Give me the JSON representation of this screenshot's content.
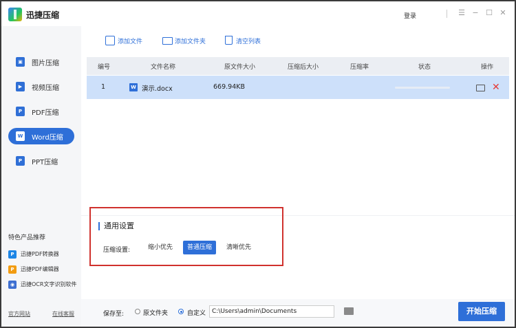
{
  "app": {
    "title": "迅捷压缩",
    "login": "登录"
  },
  "sidebar": {
    "items": [
      {
        "label": "图片压缩",
        "icon": "image-icon"
      },
      {
        "label": "视频压缩",
        "icon": "video-icon"
      },
      {
        "label": "PDF压缩",
        "icon": "pdf-icon"
      },
      {
        "label": "Word压缩",
        "icon": "word-icon",
        "active": true
      },
      {
        "label": "PPT压缩",
        "icon": "ppt-icon"
      }
    ],
    "featured_title": "特色产品推荐",
    "featured": [
      {
        "label": "迅捷PDF转换器"
      },
      {
        "label": "迅捷PDF编辑器"
      },
      {
        "label": "迅捷OCR文字识别软件"
      }
    ],
    "official_site": "官方网站",
    "online_service": "在线客服"
  },
  "toolbar": {
    "add_file": "添加文件",
    "add_folder": "添加文件夹",
    "clear_list": "清空列表"
  },
  "table": {
    "headers": [
      "编号",
      "文件名称",
      "原文件大小",
      "压缩后大小",
      "压缩率",
      "状态",
      "操作"
    ],
    "rows": [
      {
        "index": "1",
        "name": "演示.docx",
        "original_size": "669.94KB",
        "compressed_size": "",
        "ratio": "",
        "progress": 0
      }
    ]
  },
  "settings": {
    "title": "通用设置",
    "label": "压缩设置:",
    "options": [
      "缩小优先",
      "普通压缩",
      "清晰优先"
    ],
    "selected": "普通压缩"
  },
  "footer": {
    "save_to": "保存至:",
    "option_original": "原文件夹",
    "option_custom": "自定义",
    "path": "C:\\Users\\admin\\Documents",
    "start_button": "开始压缩"
  },
  "colors": {
    "accent": "#2e6fd8",
    "selected_row": "#cde0fa",
    "highlight_border": "#d0312d",
    "delete": "#e53935"
  }
}
